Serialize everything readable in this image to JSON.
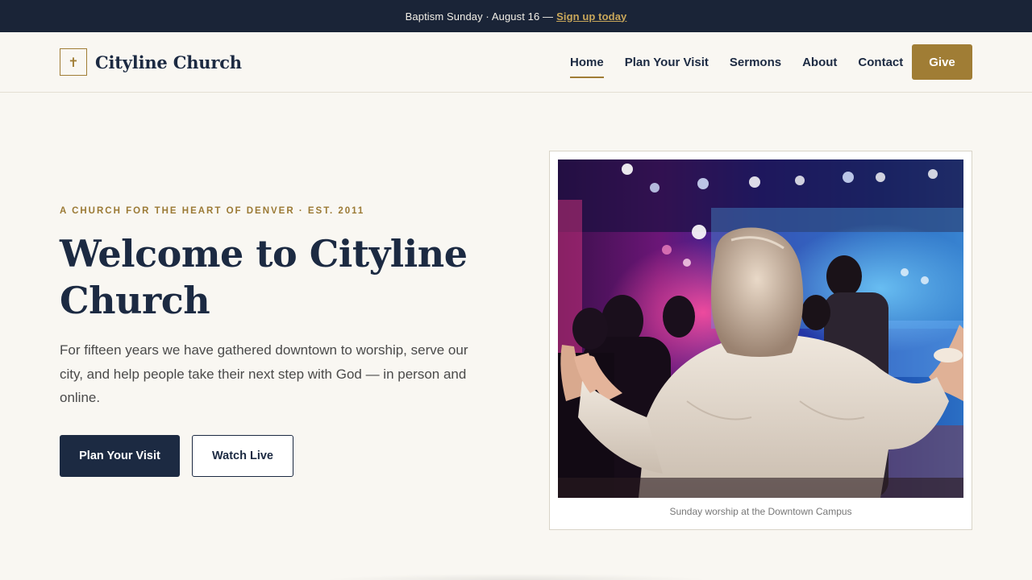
{
  "announcement": {
    "text": "Baptism Sunday · August 16 —",
    "link": "Sign up today"
  },
  "brand": {
    "mark": "✝",
    "name": "Cityline Church"
  },
  "nav": {
    "items": [
      {
        "label": "Home",
        "active": true
      },
      {
        "label": "Plan Your Visit",
        "active": false
      },
      {
        "label": "Sermons",
        "active": false
      },
      {
        "label": "About",
        "active": false
      },
      {
        "label": "Contact",
        "active": false
      }
    ],
    "give_label": "Give"
  },
  "hero": {
    "eyebrow": "A CHURCH FOR THE HEART OF DENVER · EST. 2011",
    "title": "Welcome to Cityline Church",
    "text": "For fifteen years we have gathered downtown to worship, serve our city, and help people take their next step with God — in person and online.",
    "primary_button": "Plan Your Visit",
    "secondary_button": "Watch Live"
  },
  "photo": {
    "caption": "Sunday worship at the Downtown Campus"
  },
  "colors": {
    "navy": "#1c2a42",
    "gold": "#a07d35",
    "background": "#f9f7f2",
    "announce_bg": "#1a2437"
  }
}
